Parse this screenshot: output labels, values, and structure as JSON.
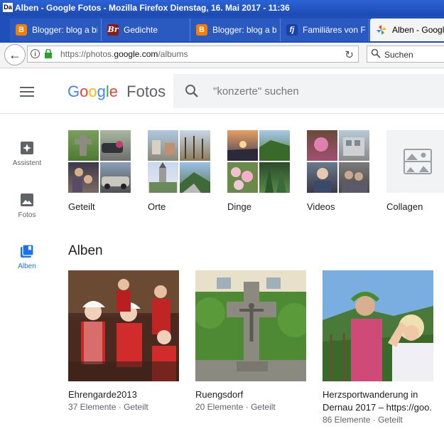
{
  "window": {
    "icon_text": "Da",
    "title": "Alben - Google Fotos - Mozilla Firefox  Dienstag, 16. Mai 2017 - 11:36"
  },
  "tabs": [
    {
      "label": "Blogger: blog a bis",
      "icon": "blogger-icon",
      "color": "#f57d00"
    },
    {
      "label": "Gedichte",
      "icon": "br-icon",
      "icon_text": "Br",
      "color": "#8b1a1a"
    },
    {
      "label": "Blogger: blog a bis",
      "icon": "blogger-icon",
      "color": "#f57d00"
    },
    {
      "label": "Familiäres von Frit",
      "icon": "fj-icon",
      "icon_text": "fj",
      "color": "#1a3fa8"
    },
    {
      "label": "Alben - Google",
      "icon": "google-photos-icon",
      "active": true
    }
  ],
  "navbar": {
    "url_prefix": "https://photos.",
    "url_host": "google.com",
    "url_suffix": "/albums",
    "search_placeholder": "Suchen"
  },
  "app": {
    "logo_google": [
      "G",
      "o",
      "o",
      "g",
      "l",
      "e"
    ],
    "logo_colors": [
      "#4285f4",
      "#ea4335",
      "#fbbc05",
      "#4285f4",
      "#34a853",
      "#ea4335"
    ],
    "logo_fotos": "Fotos",
    "search_placeholder": "\"konzerte\" suchen"
  },
  "sidebar": [
    {
      "label": "Assistent",
      "icon": "assistant-icon"
    },
    {
      "label": "Fotos",
      "icon": "photo-icon"
    },
    {
      "label": "Alben",
      "icon": "albums-icon",
      "active": true
    }
  ],
  "categories": [
    {
      "label": "Geteilt"
    },
    {
      "label": "Orte"
    },
    {
      "label": "Dinge"
    },
    {
      "label": "Videos"
    },
    {
      "label": "Collagen"
    }
  ],
  "albums_section": {
    "title": "Alben",
    "albums": [
      {
        "title": "Ehrengarde2013",
        "count": "37 Elemente",
        "shared": "Geteilt"
      },
      {
        "title": "Ruengsdorf",
        "count": "20 Elemente",
        "shared": "Geteilt"
      },
      {
        "title": "Herzsportwanderung in Dernau 2017 – https://goo.",
        "count": "86 Elemente",
        "shared": "Geteilt"
      }
    ],
    "separator": "·"
  }
}
